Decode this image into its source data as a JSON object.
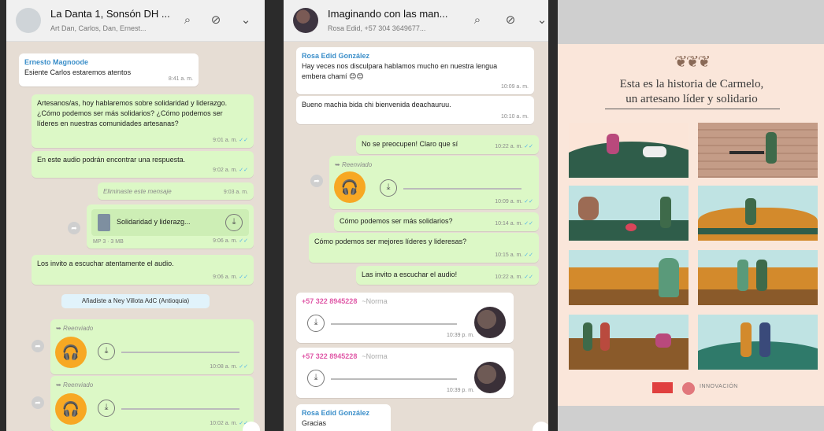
{
  "panel1": {
    "title": "La Danta 1, Sonsón DH ...",
    "subtitle": "Art Dan, Carlos, Dan, Ernest...",
    "reply_quote_sender": "Ernesto Magnoode",
    "reply_quote_text": "Esiente Carlos estaremos atentos",
    "reply_quote_time": "8:41 a. m.",
    "msg1_text": "Artesanos/as, hoy hablaremos sobre solidaridad y liderazgo. ¿Cómo podemos ser más solidarios? ¿Cómo podemos ser líderes en nuestras comunidades artesanas?",
    "msg1_time": "9:01 a. m.",
    "msg2_text": "En este audio podrán encontrar una respuesta.",
    "msg2_time": "9:02 a. m.",
    "deleted_text": "Eliminaste este mensaje",
    "deleted_time": "9:03 a. m.",
    "doc_name": "Solidaridad y liderazg...",
    "doc_meta": "MP 3 · 3 MB",
    "doc_time": "9:06 a. m.",
    "msg3_text": "Los invito a escuchar atentamente el audio.",
    "msg3_time": "9:06 a. m.",
    "system_pill": "Añadiste a Ney Villota AdC (Antioquia)",
    "fwd1_label": "Reenviado",
    "fwd1_time": "10:08 a. m.",
    "fwd2_label": "Reenviado",
    "fwd2_time": "10:02 a. m."
  },
  "panel2": {
    "title": "Imaginando con las man...",
    "subtitle": "Rosa Edid, +57 304 3649677...",
    "rosa_sender": "Rosa Edid González",
    "rosa_msg1": "Hay veces nos disculpara hablamos mucho en nuestra lengua embera chamí 😊😊",
    "rosa_msg1_time": "10:09 a. m.",
    "rosa_msg2": "Bueno machia bida chi bienvenida deachauruu.",
    "rosa_msg2_time": "10:10 a. m.",
    "out1": "No se preocupen! Claro que sí",
    "out1_time": "10:22 a. m.",
    "fwd_label": "Reenviado",
    "fwd_time": "10:09 a. m.",
    "out2": "Cómo podemos ser más solidarios?",
    "out2_time": "10:14 a. m.",
    "out3": "Cómo podemos ser mejores líderes y lideresas?",
    "out3_time": "10:15 a. m.",
    "out4": "Las invito a escuchar el audio!",
    "out4_time": "10:22 a. m.",
    "norma_sender": "+57 322 8945228",
    "norma_alias": "~Norma",
    "norma_time1": "10:39 p. m.",
    "norma_time2": "10:39 p. m.",
    "rosa_last_sender": "Rosa Edid González",
    "rosa_last_text": "Gracias"
  },
  "panel3": {
    "title_line1": "Esta es la historia de Carmelo,",
    "title_line2": "un artesano líder y solidario",
    "logo_text": "INNOVACIÓN"
  },
  "colors": {
    "out_bubble": "#dcf8c6",
    "in_bubble": "#ffffff",
    "audio_orange": "#f7a823",
    "chat_bg": "#e6ddd4",
    "info_bg": "#fae6da"
  },
  "icons": [
    "search-icon",
    "attach-icon",
    "chevron-down-icon",
    "headphones-icon",
    "download-icon",
    "document-icon",
    "forward-icon"
  ]
}
